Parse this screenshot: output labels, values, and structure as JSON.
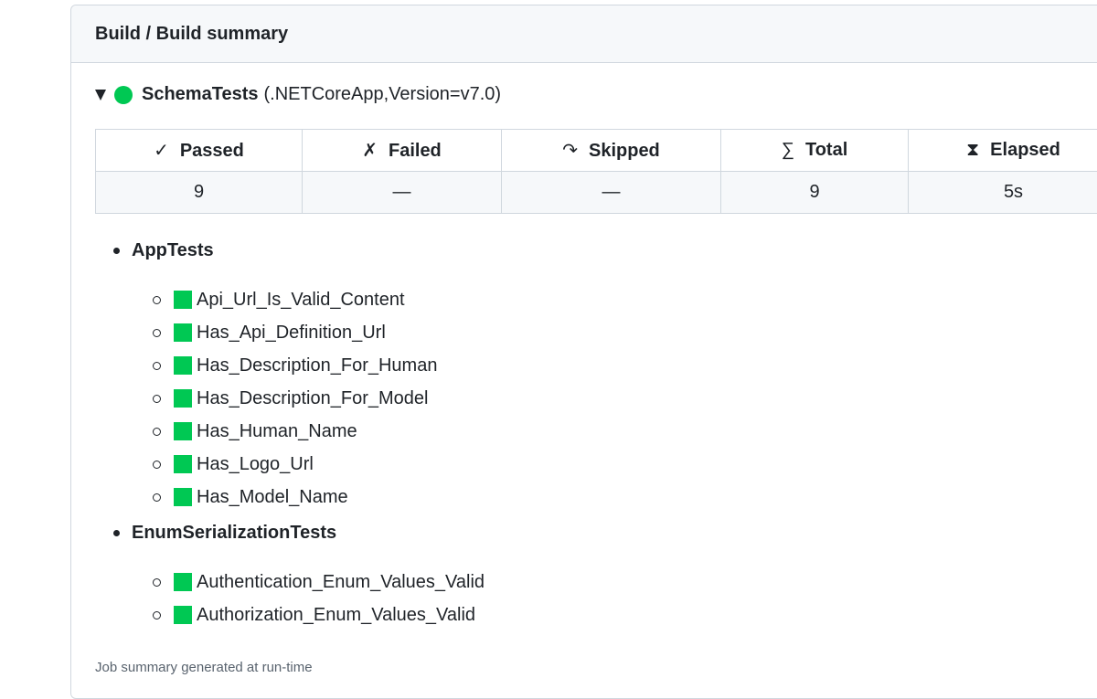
{
  "header": {
    "title": "Build / Build summary"
  },
  "suite": {
    "name": "SchemaTests",
    "framework": "(.NETCoreApp,Version=v7.0)"
  },
  "summary": {
    "columns": [
      {
        "glyph": "✓",
        "label": "Passed"
      },
      {
        "glyph": "✗",
        "label": "Failed"
      },
      {
        "glyph": "↷",
        "label": "Skipped"
      },
      {
        "glyph": "∑",
        "label": "Total"
      },
      {
        "glyph": "⧗",
        "label": "Elapsed"
      }
    ],
    "values": [
      "9",
      "—",
      "—",
      "9",
      "5s"
    ]
  },
  "groups": [
    {
      "name": "AppTests",
      "tests": [
        "Api_Url_Is_Valid_Content",
        "Has_Api_Definition_Url",
        "Has_Description_For_Human",
        "Has_Description_For_Model",
        "Has_Human_Name",
        "Has_Logo_Url",
        "Has_Model_Name"
      ]
    },
    {
      "name": "EnumSerializationTests",
      "tests": [
        "Authentication_Enum_Values_Valid",
        "Authorization_Enum_Values_Valid"
      ]
    }
  ],
  "footer": "Job summary generated at run-time",
  "colors": {
    "pass": "#00c853",
    "border": "#d0d7de",
    "header_bg": "#f6f8fa"
  }
}
